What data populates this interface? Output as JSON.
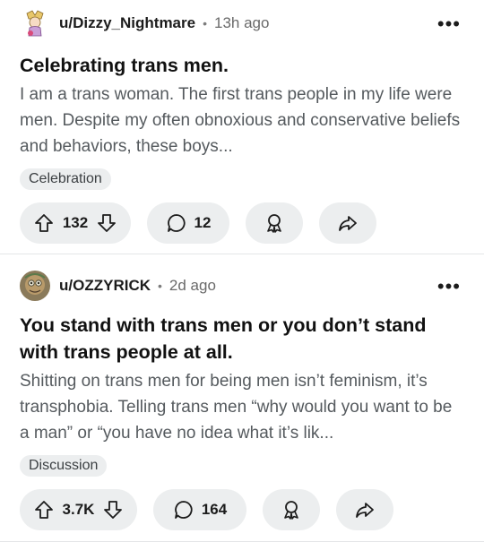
{
  "posts": [
    {
      "username": "u/Dizzy_Nightmare",
      "separator": "•",
      "time": "13h ago",
      "more": "•••",
      "title": "Celebrating trans men.",
      "body": "I am a trans woman. The first trans people in my life were men. Despite my often obnoxious and conservative beliefs and behaviors, these boys...",
      "flair": "Celebration",
      "votes": "132",
      "comments": "12"
    },
    {
      "username": "u/OZZYRICK",
      "separator": "•",
      "time": "2d ago",
      "more": "•••",
      "title": "You stand with trans men or you don’t stand with trans people at all.",
      "body": "Shitting on trans men for being men isn’t feminism, it’s transphobia. Telling trans men “why would you want to be a man” or “you have no idea what it’s lik...",
      "flair": "Discussion",
      "votes": "3.7K",
      "comments": "164"
    }
  ],
  "icons": [
    "upvote-icon",
    "downvote-icon",
    "comment-icon",
    "award-icon",
    "share-icon",
    "more-options-icon"
  ],
  "colors": {
    "pill_bg": "#eceeef",
    "text": "#1c1c1c",
    "muted": "#6a6a6a",
    "divider": "#e4e6e8"
  }
}
